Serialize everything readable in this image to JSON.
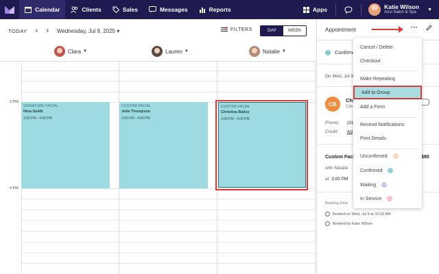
{
  "nav": {
    "items": [
      {
        "label": "Calendar",
        "icon": "calendar-icon"
      },
      {
        "label": "Clients",
        "icon": "clients-icon"
      },
      {
        "label": "Sales",
        "icon": "tag-icon"
      },
      {
        "label": "Messages",
        "icon": "messages-icon"
      },
      {
        "label": "Reports",
        "icon": "reports-icon"
      }
    ],
    "apps_label": "Apps",
    "user_name": "Katie Wilson",
    "user_location": "Azul Salon & Spa"
  },
  "toolbar": {
    "today_label": "TODAY",
    "prev": "‹",
    "next": "›",
    "date_label": "Wednesday, Jul 9, 2025 ▾",
    "filters_label": "FILTERS",
    "day_label": "DAY",
    "week_label": "WEEK"
  },
  "staff": [
    {
      "name": "Clara",
      "color": "#c2574f"
    },
    {
      "name": "Lauren",
      "color": "#5a4a44"
    },
    {
      "name": "Natalie",
      "color": "#b48a78"
    }
  ],
  "times": [
    "3 PM",
    "4 PM"
  ],
  "appointments": [
    {
      "service": "SIGNATURE FACIAL",
      "client": "Nina Smith",
      "time": "3:00 PM - 4:00 PM"
    },
    {
      "service": "CUSTOM FACIAL",
      "client": "Julie Thompson",
      "time": "3:00 PM - 4:00 PM"
    },
    {
      "service": "CUSTOM FACIAL",
      "client": "Christina Bailey",
      "time": "3:00 PM - 4:00 PM"
    }
  ],
  "panel": {
    "title": "Appointment",
    "status": "Confirme",
    "on_label": "On Wed, Jul 9",
    "initials": "CB",
    "client_name": "Chr",
    "client_sub": "Clie",
    "phone_label": "Phone:",
    "phone_val": "(31",
    "credit_label": "Credit:",
    "credit_val": "Ad",
    "service": "Custom Faci",
    "price": "$90",
    "with": "with Natalie",
    "at_label": "at",
    "at_time": "3:00 PM",
    "booking_details": "Booking Deta",
    "booked_on": "Booked on Wed, Jul 9 at 10:16 AM",
    "booked_by": "Booked by Katie Wilson"
  },
  "menu": {
    "items": [
      {
        "label": "Cancel / Delete"
      },
      {
        "label": "Checkout"
      },
      {
        "label": "Make Repeating"
      },
      {
        "label": "Add to Group"
      },
      {
        "label": "Add a Form"
      },
      {
        "label": "Resend Notifications"
      },
      {
        "label": "Print Details"
      },
      {
        "label": "Unconfirmed",
        "color": "#f8d7b4"
      },
      {
        "label": "Confirmed",
        "color": "#8fd4da"
      },
      {
        "label": "Waiting",
        "color": "#cfc6ee"
      },
      {
        "label": "In Service",
        "color": "#f6bfd6"
      }
    ]
  }
}
